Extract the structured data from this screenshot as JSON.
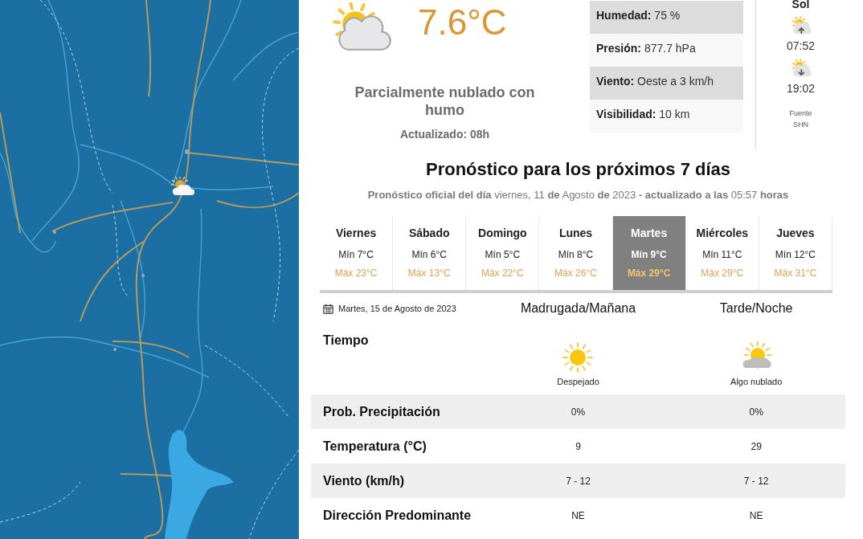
{
  "current": {
    "temperature": "7.6°C",
    "description": "Parcialmente nublado con humo",
    "updated": "Actualizado: 08h"
  },
  "conditions": [
    {
      "label": "Humedad:",
      "value": "75 %"
    },
    {
      "label": "Presión:",
      "value": "877.7 hPa"
    },
    {
      "label": "Viento:",
      "value": "Oeste a 3 km/h"
    },
    {
      "label": "Visibilidad:",
      "value": "10 km"
    }
  ],
  "sun": {
    "title": "Sol",
    "events": [
      {
        "kind": "sunrise",
        "time": "07:52"
      },
      {
        "kind": "sunset",
        "time": "19:02"
      }
    ],
    "source": "Fuente SHN"
  },
  "forecast": {
    "title": "Pronóstico para los próximos 7 días",
    "subtitle": "**Pronóstico oficial del día** viernes, 11 **de** Agosto **de** 2023 **- actualizado a las** 05:57 **horas**",
    "days": [
      {
        "name": "Viernes",
        "min": "Mín 7°C",
        "max": "Máx 23°C",
        "selected": false
      },
      {
        "name": "Sábado",
        "min": "Mín 6°C",
        "max": "Máx 13°C",
        "selected": false
      },
      {
        "name": "Domingo",
        "min": "Mín 5°C",
        "max": "Máx 22°C",
        "selected": false
      },
      {
        "name": "Lunes",
        "min": "Mín 8°C",
        "max": "Máx 26°C",
        "selected": false
      },
      {
        "name": "Martes",
        "min": "Mín 9°C",
        "max": "Máx 29°C",
        "selected": true
      },
      {
        "name": "Miércoles",
        "min": "Mín 11°C",
        "max": "Máx 29°C",
        "selected": false
      },
      {
        "name": "Jueves",
        "min": "Mín 12°C",
        "max": "Máx 31°C",
        "selected": false
      }
    ]
  },
  "detail": {
    "date": "Martes, 15 de Agosto de 2023",
    "periods": [
      "Madrugada/Mañana",
      "Tarde/Noche"
    ],
    "weather": {
      "label": "Tiempo",
      "values": [
        {
          "kind": "clear",
          "text": "Despejado"
        },
        {
          "kind": "partly-cloudy",
          "text": "Algo nublado"
        }
      ]
    },
    "rows": [
      {
        "label": "Prob. Precipitación",
        "values": [
          "0%",
          "0%"
        ]
      },
      {
        "label": "Temperatura (°C)",
        "values": [
          "9",
          "29"
        ]
      },
      {
        "label": "Viento (km/h)",
        "values": [
          "7 - 12",
          "7 - 12"
        ]
      },
      {
        "label": "Dirección Predominante",
        "values": [
          "NE",
          "NE"
        ]
      }
    ]
  }
}
